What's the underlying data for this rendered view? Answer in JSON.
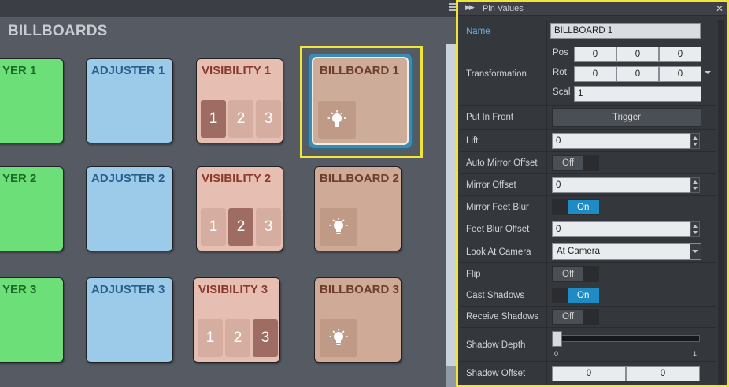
{
  "canvas": {
    "group_title": "BILLBOARDS",
    "nodes": [
      {
        "title": "YER 1",
        "color": "#6ddf78"
      },
      {
        "title": "ADJUSTER 1",
        "color": "#9ccbea"
      },
      {
        "title": "VISIBILITY 1",
        "color": "#e7bfb2",
        "buttons": [
          "1",
          "2",
          "3"
        ],
        "active": 0
      },
      {
        "title": "BILLBOARD 1",
        "color": "#cdac99",
        "selected": true
      },
      {
        "title": "YER 2"
      },
      {
        "title": "ADJUSTER 2"
      },
      {
        "title": "VISIBILITY 2",
        "buttons": [
          "1",
          "2",
          "3"
        ],
        "active": 1
      },
      {
        "title": "BILLBOARD 2"
      },
      {
        "title": "YER 3"
      },
      {
        "title": "ADJUSTER 3"
      },
      {
        "title": "VISIBILITY 3",
        "buttons": [
          "1",
          "2",
          "3"
        ],
        "active": 2
      },
      {
        "title": "BILLBOARD 3"
      }
    ],
    "bulb_icon": "lightbulb-icon"
  },
  "panel": {
    "title": "Pin Values",
    "rows": {
      "name": {
        "label": "Name",
        "value": "BILLBOARD 1"
      },
      "transformation": {
        "label": "Transformation",
        "pos_label": "Pos",
        "pos": [
          "0",
          "0",
          "0"
        ],
        "rot_label": "Rot",
        "rot": [
          "0",
          "0",
          "0"
        ],
        "scal_label": "Scal",
        "scal": "1"
      },
      "put_in_front": {
        "label": "Put In Front",
        "button": "Trigger"
      },
      "lift": {
        "label": "Lift",
        "value": "0"
      },
      "auto_mirror_offset": {
        "label": "Auto Mirror Offset",
        "state": "Off"
      },
      "mirror_offset": {
        "label": "Mirror Offset",
        "value": "0"
      },
      "mirror_feet_blur": {
        "label": "Mirror Feet Blur",
        "state": "On"
      },
      "feet_blur_offset": {
        "label": "Feet Blur Offset",
        "value": "0"
      },
      "look_at_camera": {
        "label": "Look At Camera",
        "value": "At Camera"
      },
      "flip": {
        "label": "Flip",
        "state": "Off"
      },
      "cast_shadows": {
        "label": "Cast Shadows",
        "state": "On"
      },
      "receive_shadows": {
        "label": "Receive Shadows",
        "state": "Off"
      },
      "shadow_depth": {
        "label": "Shadow Depth",
        "min": "0",
        "max": "1",
        "value": 0
      },
      "shadow_offset": {
        "label": "Shadow Offset",
        "x": "0",
        "y": "0"
      }
    }
  },
  "colors": {
    "selection": "#f0e63a",
    "accent": "#5fb1e6",
    "toggle_on": "#1f8bc4"
  }
}
